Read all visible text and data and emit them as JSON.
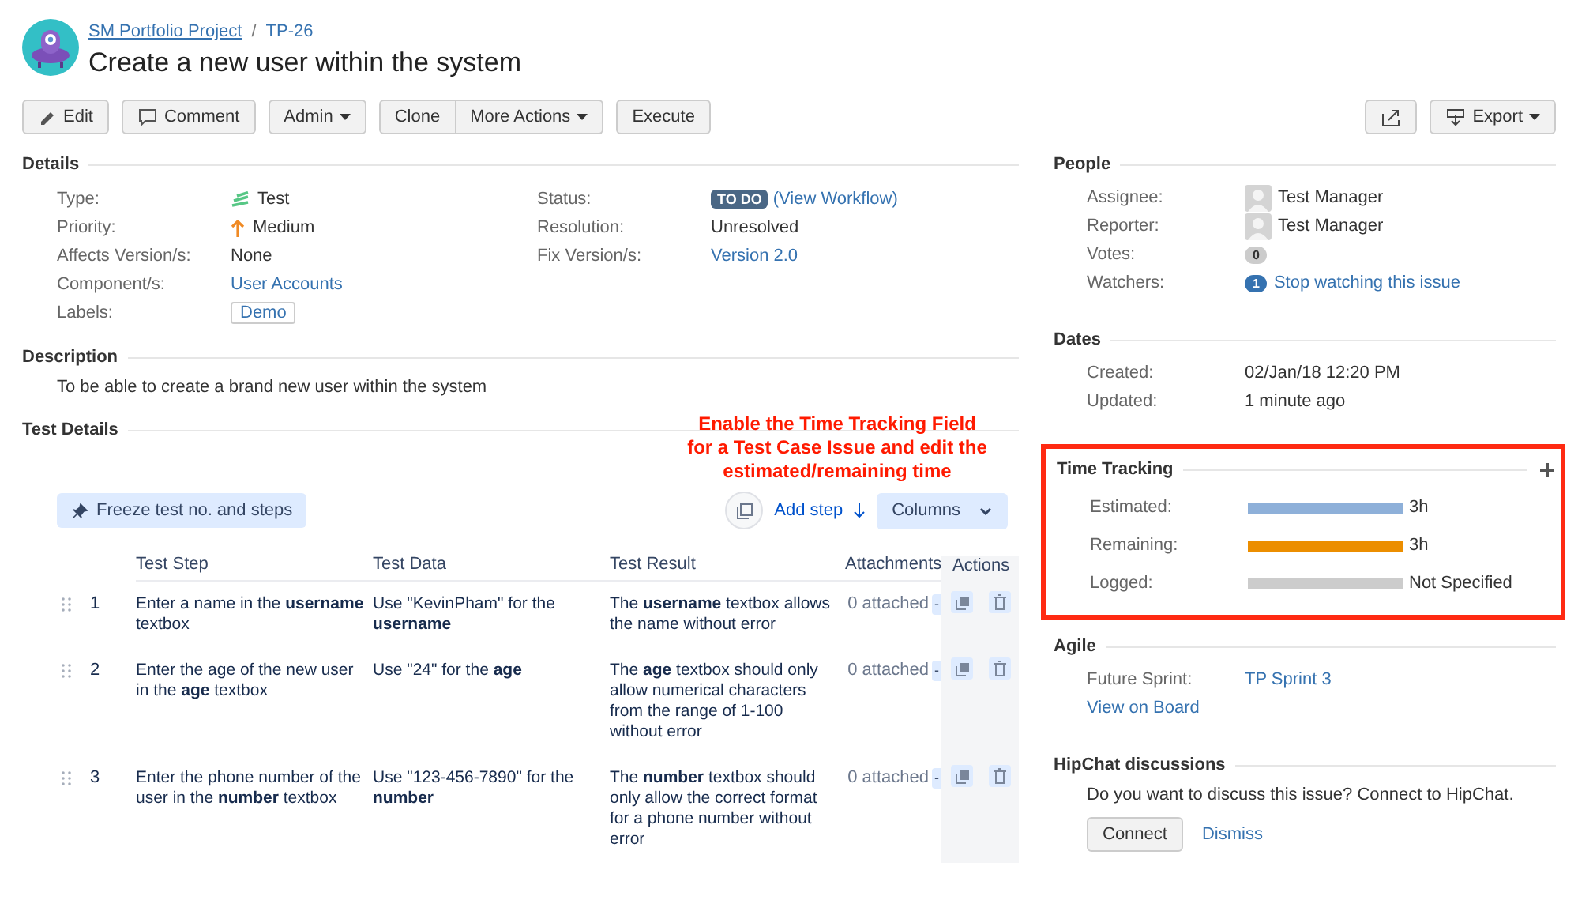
{
  "header": {
    "breadcrumb": [
      {
        "label": "SM Portfolio Project"
      },
      {
        "label": "TP-26"
      }
    ],
    "separator": "/",
    "title": "Create a new user within the system"
  },
  "toolbar": [
    {
      "buttons": [
        {
          "label": "Edit",
          "kind": "edit"
        }
      ]
    },
    {
      "buttons": [
        {
          "label": "Comment",
          "kind": "comment"
        }
      ]
    },
    {
      "buttons": [
        {
          "label": "Admin",
          "kind": "menu"
        }
      ]
    },
    {
      "buttons": [
        {
          "label": "Clone",
          "kind": "plain"
        },
        {
          "label": "More Actions",
          "kind": "menu"
        }
      ]
    },
    {
      "buttons": [
        {
          "label": "Execute",
          "kind": "plain"
        }
      ]
    }
  ],
  "toolbar_right": [
    {
      "buttons": [
        {
          "kind": "share"
        }
      ]
    },
    {
      "buttons": [
        {
          "label": "Export",
          "kind": "export"
        }
      ]
    }
  ],
  "details": {
    "title": "Details",
    "columns": [
      [
        {
          "label": "Type:",
          "value": {
            "kind": "type",
            "text": "Test"
          }
        },
        {
          "label": "Priority:",
          "value": {
            "kind": "priority",
            "text": "Medium"
          }
        },
        {
          "label": "Affects Version/s:",
          "value": {
            "kind": "text",
            "text": "None"
          }
        },
        {
          "label": "Component/s:",
          "value": {
            "kind": "link",
            "text": "User Accounts"
          }
        },
        {
          "label": "Labels:",
          "value": {
            "kind": "label",
            "text": "Demo"
          }
        }
      ],
      [
        {
          "label": "Status:",
          "value": {
            "kind": "status",
            "text": "TO DO",
            "link": "(View Workflow)"
          }
        },
        {
          "label": "Resolution:",
          "value": {
            "kind": "text",
            "text": "Unresolved"
          }
        },
        {
          "label": "Fix Version/s:",
          "value": {
            "kind": "link",
            "text": "Version 2.0"
          }
        }
      ]
    ]
  },
  "description": {
    "title": "Description",
    "text": "To be able to create a brand new user within the system"
  },
  "test_details": {
    "title": "Test Details",
    "annotation": [
      "Enable the Time Tracking Field",
      "for a Test Case Issue and edit the",
      "estimated/remaining time"
    ],
    "freeze_button": "Freeze test no. and steps",
    "add_step": "Add step",
    "columns_button": "Columns",
    "columns": [
      "Test Step",
      "Test Data",
      "Test Result",
      "Attachments",
      "Actions"
    ],
    "rows": [
      {
        "number": "1",
        "step": "Enter a name in the **username** textbox",
        "data": "Use \"KevinPham\" for the **username**",
        "result": "The **username** textbox allows the name without error",
        "attachments": "0 attached",
        "attach_control": "-"
      },
      {
        "number": "2",
        "step": "Enter the age of the new user in the **age** textbox",
        "data": "Use \"24\" for the **age**",
        "result": "The **age** textbox should only allow numerical characters from the range of 1-100 without error",
        "attachments": "0 attached",
        "attach_control": "-"
      },
      {
        "number": "3",
        "step": "Enter the phone number of the user in the **number** textbox",
        "data": "Use \"123-456-7890\" for the **number**",
        "result": "The **number** textbox should only allow the correct format for a phone number without error",
        "attachments": "0 attached",
        "attach_control": "-"
      }
    ]
  },
  "people": {
    "title": "People",
    "rows": [
      {
        "label": "Assignee:",
        "kind": "user",
        "text": "Test Manager"
      },
      {
        "label": "Reporter:",
        "kind": "user",
        "text": "Test Manager"
      },
      {
        "label": "Votes:",
        "kind": "count",
        "count": "0"
      },
      {
        "label": "Watchers:",
        "kind": "watch",
        "count": "1",
        "text": "Stop watching this issue"
      }
    ]
  },
  "dates": {
    "title": "Dates",
    "rows": [
      {
        "label": "Created:",
        "value": "02/Jan/18 12:20 PM"
      },
      {
        "label": "Updated:",
        "value": "1 minute ago"
      }
    ]
  },
  "time_tracking": {
    "title": "Time Tracking",
    "highlighted": true,
    "rows": [
      {
        "label": "Estimated:",
        "level": 1,
        "color": "#8eb0d9",
        "reading": "3h"
      },
      {
        "label": "Remaining:",
        "level": 1,
        "color": "#ec8e00",
        "reading": "3h"
      },
      {
        "label": "Logged:",
        "reading": "Not Specified"
      }
    ]
  },
  "agile": {
    "title": "Agile",
    "label": "Future Sprint:",
    "sprint": "TP Sprint 3",
    "board_link": "View on Board"
  },
  "hipchat": {
    "title": "HipChat discussions",
    "text": "Do you want to discuss this issue? Connect to HipChat.",
    "connect": "Connect",
    "dismiss": "Dismiss"
  }
}
